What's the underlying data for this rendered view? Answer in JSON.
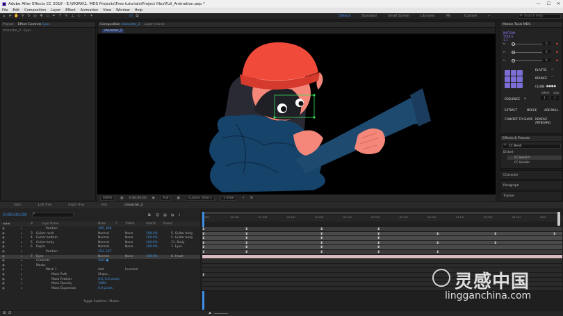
{
  "window": {
    "title": "Adobe After Effects CC 2018 - E:\\WORK\\1. MDS Projects\\Free tutorials\\Project files\\Full_Animation.aep *",
    "minimize": "—",
    "maximize": "☐",
    "close": "✕"
  },
  "menu": [
    "File",
    "Edit",
    "Composition",
    "Layer",
    "Effect",
    "Animation",
    "View",
    "Window",
    "Help"
  ],
  "workspaces": [
    "Default",
    "Standard",
    "Small Screen",
    "Libraries",
    "My",
    "Custom"
  ],
  "workspace_more": "»",
  "search_help": "Search Help",
  "left_panel": {
    "tab_project": "Project",
    "tab_effect_controls": "Effect Controls",
    "effect_controls_target": "Eyes",
    "subtitle": "character_2 · Eyes"
  },
  "viewer": {
    "tab_composition": "Composition",
    "comp_name": "character_2",
    "tab_layer": "Layer (none)",
    "comp_chip": "character_2",
    "zoom": "400%",
    "timecode": "0:00:00:00",
    "resolution": "Full",
    "camera": "Custom View 1",
    "views": "1 View"
  },
  "motion_tools": {
    "title": "Motion Tools MDS",
    "logo": "MOTION TOOLS 1.1",
    "elastic": "ELASTIC",
    "bounce": "BOUNCE",
    "clone": "CLONE",
    "offset": "offset",
    "step": "step",
    "sequence": "SEQUENCE",
    "extract": "EXTRACT",
    "merge": "MERGE",
    "add_null": "ADD NULL",
    "convert_to_shape": "CONVERT TO SHAPE",
    "remove_artboard": "REMOVE ARTBOARD",
    "slider_values": [
      "0",
      "0",
      "0"
    ]
  },
  "effects_presets": {
    "title": "Effects & Presets",
    "search": "CC Bend",
    "folder": "Distort",
    "items": [
      "CC Bend It",
      "CC Bender"
    ]
  },
  "right_collapsed": [
    "Character",
    "Paragraph",
    "Tracker"
  ],
  "timeline": {
    "tabs": [
      "Intro",
      "Left Tree",
      "Right Tree",
      "Fish",
      "character_2"
    ],
    "timecode": "0:00:00:00",
    "search_placeholder": "",
    "columns": [
      "#",
      "Layer Name",
      "Mode",
      "T",
      "TrkMat",
      "Stretch",
      "Parent"
    ],
    "ruler": [
      "0:00f",
      "00:12f",
      "01:00f",
      "01:12f",
      "02:00f",
      "02:12f",
      "03:00f",
      "03:12f",
      "04:00f",
      "04:12f",
      "05:00f",
      "05:12f",
      "06:0"
    ],
    "rows": [
      {
        "num": "",
        "name": "Position",
        "mode": "",
        "trk": "",
        "stretch": "",
        "parent": "",
        "value": "305, 466"
      },
      {
        "num": "3",
        "name": "Guitar neck",
        "mode": "Normal",
        "trk": "None",
        "stretch": "100.0%",
        "parent": "5. Guitar body"
      },
      {
        "num": "4",
        "name": "Guitar bottom",
        "mode": "Normal",
        "trk": "None",
        "stretch": "100.0%",
        "parent": "5. Guitar body"
      },
      {
        "num": "5",
        "name": "Guitar body",
        "mode": "Normal",
        "trk": "None",
        "stretch": "100.0%",
        "parent": "11. Body"
      },
      {
        "num": "6",
        "name": "Pupils",
        "mode": "Normal",
        "trk": "None",
        "stretch": "100.0%",
        "parent": "7. Eyes"
      },
      {
        "num": "",
        "name": "Position",
        "mode": "",
        "trk": "",
        "stretch": "",
        "parent": "",
        "value": "153, 227"
      },
      {
        "num": "7",
        "name": "Eyes",
        "mode": "Normal",
        "trk": "None",
        "stretch": "100.0%",
        "parent": "8. Head"
      },
      {
        "num": "",
        "name": "Contents",
        "mode": "",
        "trk": "",
        "stretch": "",
        "parent": "",
        "value": "Add: ●"
      },
      {
        "num": "",
        "name": "Masks",
        "mode": "",
        "trk": "",
        "stretch": "",
        "parent": ""
      },
      {
        "num": "",
        "name": "Mask 1",
        "mode": "Add",
        "trk": "Inverted",
        "stretch": "",
        "parent": ""
      },
      {
        "num": "",
        "name": "Mask Path",
        "mode": "Shape...",
        "trk": "",
        "stretch": "",
        "parent": ""
      },
      {
        "num": "",
        "name": "Mask Feather",
        "mode": "",
        "trk": "",
        "stretch": "",
        "parent": "",
        "value": "0.0, 0.0 pixels"
      },
      {
        "num": "",
        "name": "Mask Opacity",
        "mode": "",
        "trk": "",
        "stretch": "",
        "parent": "",
        "value": "100%"
      },
      {
        "num": "",
        "name": "Mask Expansion",
        "mode": "",
        "trk": "",
        "stretch": "",
        "parent": "",
        "value": "0.0 pixels"
      }
    ],
    "toggle_label": "Toggle Switches / Modes"
  },
  "watermark": {
    "cn": "灵感中国",
    "url": "lingganchina.com"
  }
}
